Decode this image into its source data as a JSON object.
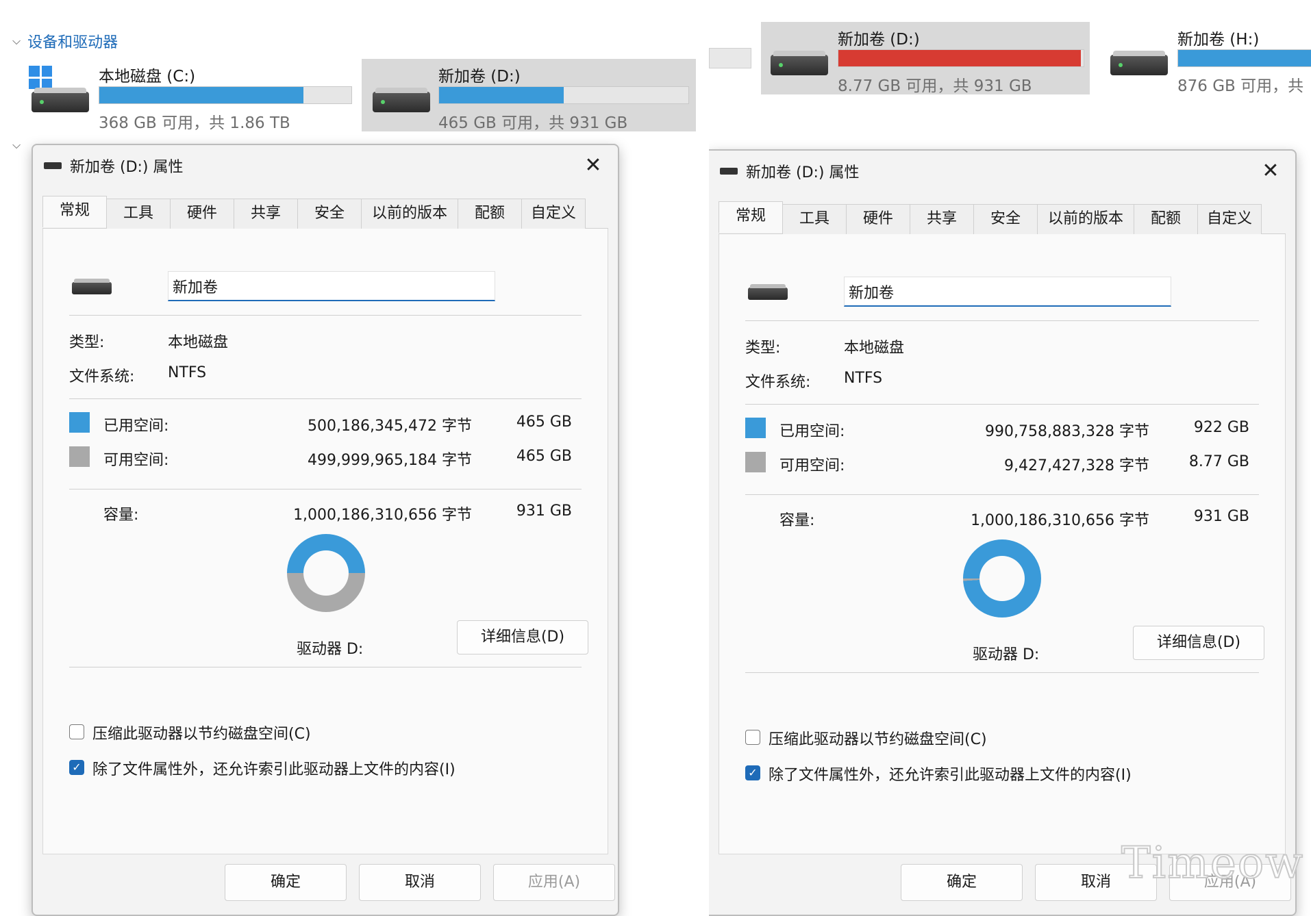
{
  "left": {
    "section_devices": "设备和驱动器",
    "drives": [
      {
        "name": "本地磁盘 (C:)",
        "used_fraction": 0.81,
        "free_text": "368 GB 可用，共 1.86 TB"
      },
      {
        "name": "新加卷 (D:)",
        "used_fraction": 0.5,
        "free_text": "465 GB 可用，共 931 GB"
      }
    ],
    "dialog": {
      "title": "新加卷 (D:) 属性",
      "tabs": [
        "常规",
        "工具",
        "硬件",
        "共享",
        "安全",
        "以前的版本",
        "配额",
        "自定义"
      ],
      "volume_name": "新加卷",
      "type_label": "类型:",
      "type_value": "本地磁盘",
      "fs_label": "文件系统:",
      "fs_value": "NTFS",
      "used_label": "已用空间:",
      "used_bytes": "500,186,345,472 字节",
      "used_size": "465 GB",
      "free_label": "可用空间:",
      "free_bytes": "499,999,965,184 字节",
      "free_size": "465 GB",
      "capacity_label": "容量:",
      "capacity_bytes": "1,000,186,310,656 字节",
      "capacity_size": "931 GB",
      "used_fraction": 0.5,
      "drive_label": "驱动器 D:",
      "details_button": "详细信息(D)",
      "compress_label": "压缩此驱动器以节约磁盘空间(C)",
      "index_label": "除了文件属性外，还允许索引此驱动器上文件的内容(I)",
      "ok": "确定",
      "cancel": "取消",
      "apply": "应用(A)"
    }
  },
  "right": {
    "drives": [
      {
        "name": "新加卷 (D:)",
        "used_fraction": 0.99,
        "free_text": "8.77 GB 可用，共 931 GB"
      },
      {
        "name": "新加卷 (H:)",
        "used_fraction": 1.0,
        "free_text": "876 GB 可用，共"
      }
    ],
    "dialog": {
      "title": "新加卷 (D:) 属性",
      "tabs": [
        "常规",
        "工具",
        "硬件",
        "共享",
        "安全",
        "以前的版本",
        "配额",
        "自定义"
      ],
      "volume_name": "新加卷",
      "type_label": "类型:",
      "type_value": "本地磁盘",
      "fs_label": "文件系统:",
      "fs_value": "NTFS",
      "used_label": "已用空间:",
      "used_bytes": "990,758,883,328 字节",
      "used_size": "922 GB",
      "free_label": "可用空间:",
      "free_bytes": "9,427,427,328 字节",
      "free_size": "8.77 GB",
      "capacity_label": "容量:",
      "capacity_bytes": "1,000,186,310,656 字节",
      "capacity_size": "931 GB",
      "used_fraction": 0.99,
      "drive_label": "驱动器 D:",
      "details_button": "详细信息(D)",
      "compress_label": "压缩此驱动器以节约磁盘空间(C)",
      "index_label": "除了文件属性外，还允许索引此驱动器上文件的内容(I)",
      "ok": "确定",
      "cancel": "取消",
      "apply": "应用(A)"
    }
  },
  "watermark": "Timeow",
  "colors": {
    "used": "#3a9ad9",
    "free": "#a9a9a9",
    "full_bar": "#d73b32",
    "accent": "#1e6bb8"
  }
}
